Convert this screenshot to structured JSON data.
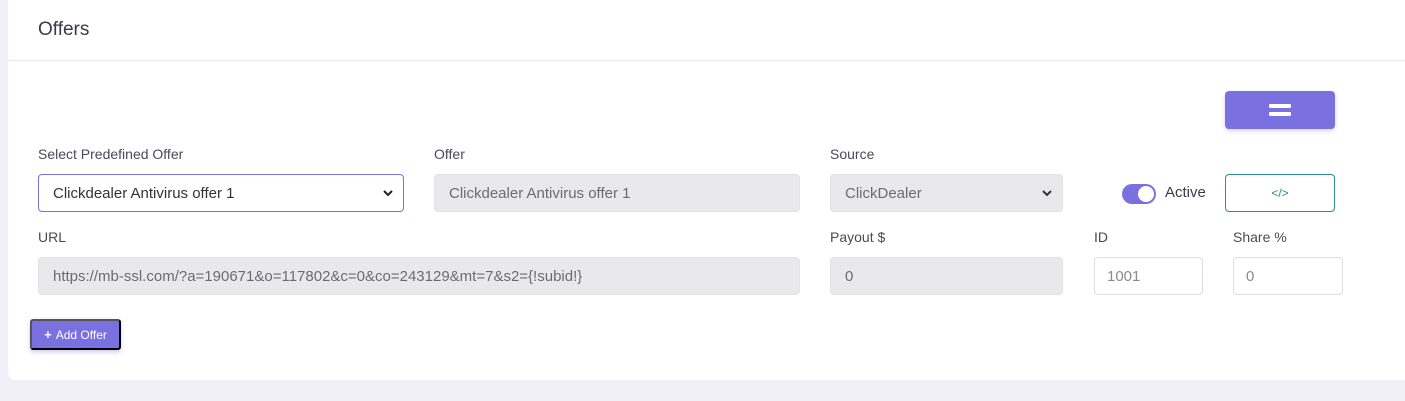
{
  "card": {
    "title": "Offers"
  },
  "form": {
    "predefined_label": "Select Predefined Offer",
    "predefined_value": "Clickdealer Antivirus offer 1",
    "offer_label": "Offer",
    "offer_value": "Clickdealer Antivirus offer 1",
    "source_label": "Source",
    "source_value": "ClickDealer",
    "active_label": "Active",
    "active_on": true,
    "url_label": "URL",
    "url_value": "https://mb-ssl.com/?a=190671&o=117802&c=0&co=243129&mt=7&s2={!subid!}",
    "payout_label": "Payout $",
    "payout_value": "0",
    "id_label": "ID",
    "id_value": "1001",
    "share_label": "Share %",
    "share_value": "0"
  },
  "buttons": {
    "code_label": "</>",
    "add_plus": "+",
    "add_label": "Add Offer"
  },
  "icons": {
    "menu": "menu-icon",
    "code": "code-icon",
    "chevron": "chevron-down-icon",
    "plus": "plus-icon"
  },
  "colors": {
    "accent": "#7b70e0",
    "teal": "#2a8c95"
  }
}
